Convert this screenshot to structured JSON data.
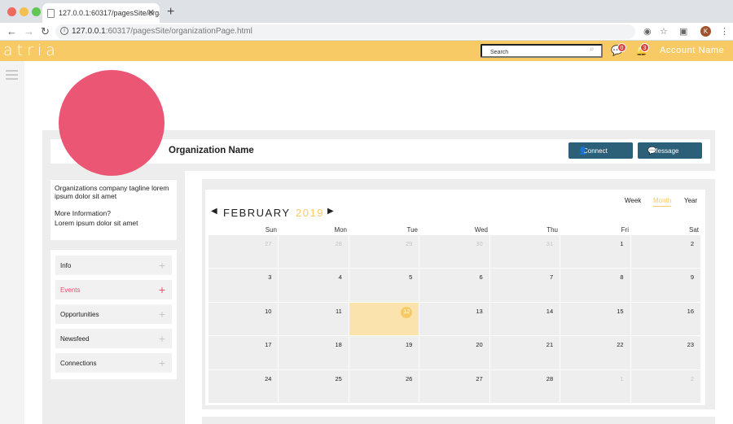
{
  "browser": {
    "tab_title": "127.0.0.1:60317/pagesSite/orga",
    "tab_close": "✕",
    "new_tab": "+",
    "url_host": "127.0.0.1",
    "url_rest": ":60317/pagesSite/organizationPage.html",
    "profile_initial": "K"
  },
  "header": {
    "logo": "atria",
    "search_placeholder": "Search",
    "messages_count": "0",
    "notifications_count": "3",
    "account": "Account Name"
  },
  "org": {
    "name": "Organization Name",
    "connect_label": "Connect",
    "message_label": "Message",
    "tagline": "Organizations company tagline lorem ipsum dolor sit amet",
    "more_info_label": "More Information?",
    "more_info_text": "Lorem ipsum dolor sit amet"
  },
  "menu": {
    "items": [
      {
        "label": "Info",
        "active": false
      },
      {
        "label": "Events",
        "active": true
      },
      {
        "label": "Opportunities",
        "active": false
      },
      {
        "label": "Newsfeed",
        "active": false
      },
      {
        "label": "Connections",
        "active": false
      }
    ],
    "plus": "+"
  },
  "calendar": {
    "views": [
      "Week",
      "Month",
      "Year"
    ],
    "active_view": "Month",
    "month": "FEBRUARY",
    "year": "2019",
    "weekdays": [
      "Sun",
      "Mon",
      "Tue",
      "Wed",
      "Thu",
      "Fri",
      "Sat"
    ],
    "days": [
      {
        "d": "27",
        "muted": true
      },
      {
        "d": "28",
        "muted": true
      },
      {
        "d": "29",
        "muted": true
      },
      {
        "d": "30",
        "muted": true
      },
      {
        "d": "31",
        "muted": true
      },
      {
        "d": "1"
      },
      {
        "d": "2"
      },
      {
        "d": "3"
      },
      {
        "d": "4"
      },
      {
        "d": "5"
      },
      {
        "d": "6"
      },
      {
        "d": "7"
      },
      {
        "d": "8"
      },
      {
        "d": "9"
      },
      {
        "d": "10"
      },
      {
        "d": "11"
      },
      {
        "d": "12",
        "today": true
      },
      {
        "d": "13"
      },
      {
        "d": "14"
      },
      {
        "d": "15"
      },
      {
        "d": "16"
      },
      {
        "d": "17"
      },
      {
        "d": "18"
      },
      {
        "d": "19"
      },
      {
        "d": "20"
      },
      {
        "d": "21"
      },
      {
        "d": "22"
      },
      {
        "d": "23"
      },
      {
        "d": "24"
      },
      {
        "d": "25"
      },
      {
        "d": "26"
      },
      {
        "d": "27"
      },
      {
        "d": "28"
      },
      {
        "d": "1",
        "muted": true
      },
      {
        "d": "2",
        "muted": true
      }
    ]
  },
  "colors": {
    "brand_yellow": "#f8ca66",
    "avatar_pink": "#eb5675",
    "button_blue": "#2c5f78",
    "active_pink": "#e8506f",
    "badge_red": "#e0413a"
  }
}
